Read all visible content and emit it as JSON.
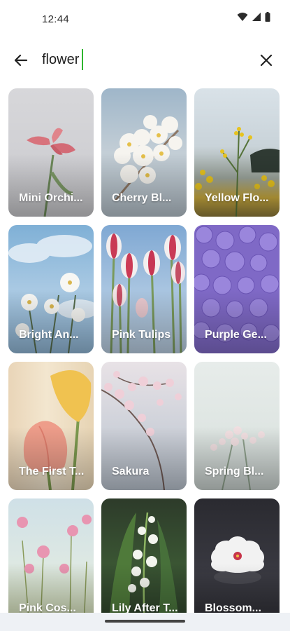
{
  "status_bar": {
    "time": "12:44",
    "icons": [
      "wifi-icon",
      "signal-icon",
      "battery-icon"
    ]
  },
  "search": {
    "value": "flower",
    "back_icon": "arrow-left-icon",
    "clear_icon": "close-icon",
    "caret_color": "#2fb52f"
  },
  "results": [
    {
      "title": "Mini Orchi...",
      "theme": "pink orchid on grey"
    },
    {
      "title": "Cherry Bl...",
      "theme": "white cherry blossoms"
    },
    {
      "title": "Yellow Flo...",
      "theme": "yellow flowers field"
    },
    {
      "title": "Bright An...",
      "theme": "white cosmos blue sky"
    },
    {
      "title": "Pink Tulips",
      "theme": "pink white tulips"
    },
    {
      "title": "Purple Ge...",
      "theme": "purple hydrangea"
    },
    {
      "title": "The First T...",
      "theme": "peach tulips"
    },
    {
      "title": "Sakura",
      "theme": "sakura branch"
    },
    {
      "title": "Spring Bl...",
      "theme": "pale pink blossoms"
    },
    {
      "title": "Pink Cos...",
      "theme": "pink cosmos field"
    },
    {
      "title": "Lily After T...",
      "theme": "lily of the valley"
    },
    {
      "title": "Blossom...",
      "theme": "white camellia on dark"
    }
  ]
}
